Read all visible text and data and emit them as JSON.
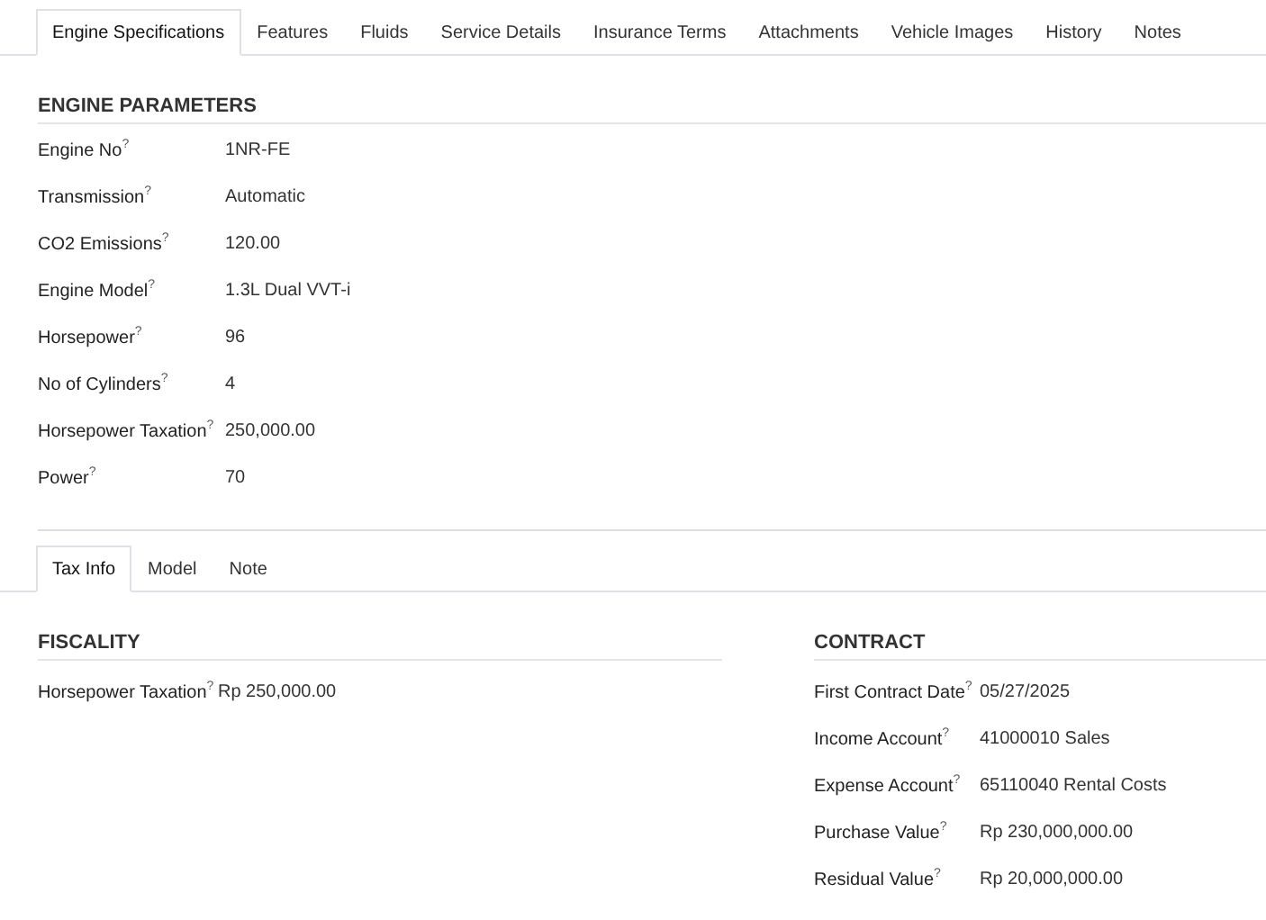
{
  "tabs": [
    {
      "label": "Engine Specifications",
      "selected": true
    },
    {
      "label": "Features",
      "selected": false
    },
    {
      "label": "Fluids",
      "selected": false
    },
    {
      "label": "Service Details",
      "selected": false
    },
    {
      "label": "Insurance Terms",
      "selected": false
    },
    {
      "label": "Attachments",
      "selected": false
    },
    {
      "label": "Vehicle Images",
      "selected": false
    },
    {
      "label": "History",
      "selected": false
    },
    {
      "label": "Notes",
      "selected": false
    }
  ],
  "engine_parameters": {
    "title": "ENGINE PARAMETERS",
    "fields": [
      {
        "label": "Engine No",
        "help": "?",
        "value": "1NR-FE"
      },
      {
        "label": "Transmission",
        "help": "?",
        "value": "Automatic"
      },
      {
        "label": "CO2 Emissions",
        "help": "?",
        "value": "120.00"
      },
      {
        "label": "Engine Model",
        "help": "?",
        "value": "1.3L Dual VVT-i"
      },
      {
        "label": "Horsepower",
        "help": "?",
        "value": "96"
      },
      {
        "label": "No of Cylinders",
        "help": "?",
        "value": "4"
      },
      {
        "label": "Horsepower Taxation",
        "help": "?",
        "value": "250,000.00"
      },
      {
        "label": "Power",
        "help": "?",
        "value": "70"
      }
    ]
  },
  "sub_tabs": [
    {
      "label": "Tax Info",
      "selected": true
    },
    {
      "label": "Model",
      "selected": false
    },
    {
      "label": "Note",
      "selected": false
    }
  ],
  "fiscality": {
    "title": "FISCALITY",
    "fields": [
      {
        "label": "Horsepower Taxation",
        "help": "?",
        "value": "Rp 250,000.00"
      }
    ]
  },
  "contract": {
    "title": "CONTRACT",
    "fields": [
      {
        "label": "First Contract Date",
        "help": "?",
        "value": "05/27/2025"
      },
      {
        "label": "Income Account",
        "help": "?",
        "value": "41000010 Sales"
      },
      {
        "label": "Expense Account",
        "help": "?",
        "value": "65110040 Rental Costs"
      },
      {
        "label": "Purchase Value",
        "help": "?",
        "value": "Rp 230,000,000.00"
      },
      {
        "label": "Residual Value",
        "help": "?",
        "value": "Rp 20,000,000.00"
      }
    ]
  }
}
